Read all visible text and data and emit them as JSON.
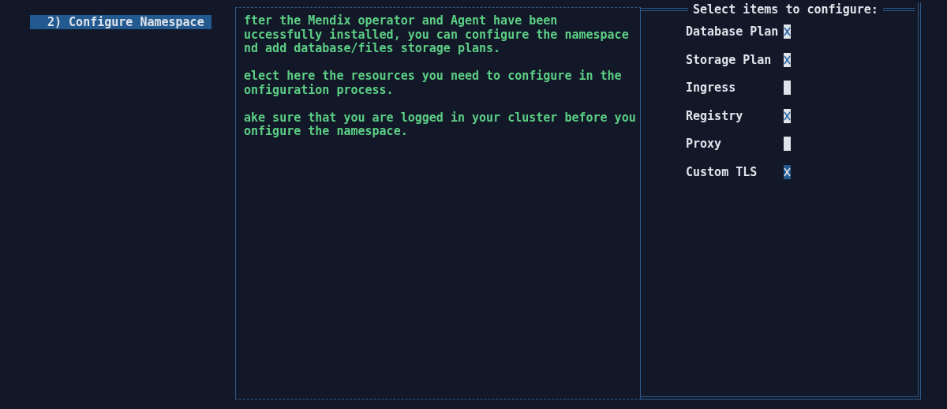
{
  "sidebar": {
    "items": [
      {
        "label": "2) Configure Namespace",
        "selected": true
      }
    ]
  },
  "description": {
    "paragraphs": [
      "fter the Mendix operator and Agent have been\nuccessfully installed, you can configure the namespace\nnd add database/files storage plans.",
      "elect here the resources you need to configure in the\nonfiguration process.",
      "ake sure that you are logged in your cluster before you\nonfigure the namespace."
    ]
  },
  "options": {
    "title": "Select items to configure:",
    "items": [
      {
        "label": "Database Plan",
        "checked": true,
        "focused": false
      },
      {
        "label": "Storage Plan",
        "checked": true,
        "focused": false
      },
      {
        "label": "Ingress",
        "checked": false,
        "focused": false
      },
      {
        "label": "Registry",
        "checked": true,
        "focused": false
      },
      {
        "label": "Proxy",
        "checked": false,
        "focused": false
      },
      {
        "label": "Custom TLS",
        "checked": true,
        "focused": true
      }
    ]
  }
}
